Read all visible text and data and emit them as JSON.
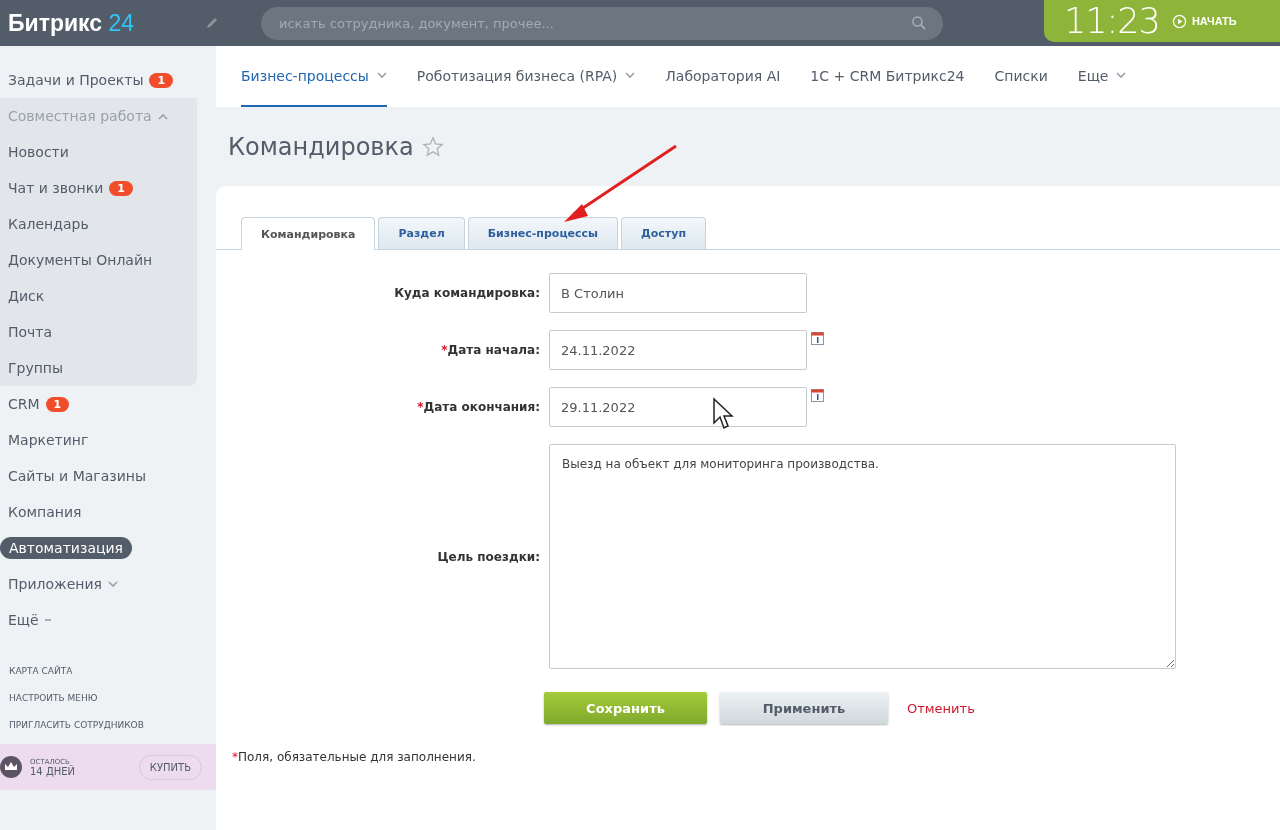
{
  "header": {
    "logo_text": "Битрикс",
    "logo_number": "24",
    "search": {
      "placeholder": "искать сотрудника, документ, прочее..."
    },
    "clock": {
      "time": "11:23",
      "action": "НАЧАТЬ"
    }
  },
  "sidebar": {
    "items": [
      {
        "kind": "link",
        "label": "Задачи и Проекты",
        "badge": "1",
        "selected": false
      },
      {
        "kind": "group",
        "label": "Совместная работа",
        "expanded": true,
        "selected": false,
        "children": [
          {
            "kind": "link",
            "label": "Новости",
            "selected": false
          },
          {
            "kind": "link",
            "label": "Чат и звонки",
            "badge": "1",
            "selected": false
          },
          {
            "kind": "link",
            "label": "Календарь",
            "selected": false
          },
          {
            "kind": "link",
            "label": "Документы Онлайн",
            "selected": false
          },
          {
            "kind": "link",
            "label": "Диск",
            "selected": false
          },
          {
            "kind": "link",
            "label": "Почта",
            "selected": false
          },
          {
            "kind": "link",
            "label": "Группы",
            "selected": false
          }
        ]
      },
      {
        "kind": "link",
        "label": "CRM",
        "badge": "1",
        "selected": false
      },
      {
        "kind": "link",
        "label": "Маркетинг",
        "selected": false
      },
      {
        "kind": "link",
        "label": "Сайты и Магазины",
        "selected": false
      },
      {
        "kind": "link",
        "label": "Компания",
        "selected": false
      },
      {
        "kind": "link",
        "label": "Автоматизация",
        "selected": true
      },
      {
        "kind": "dropdown",
        "label": "Приложения",
        "selected": false
      },
      {
        "kind": "more",
        "label": "Ещё",
        "selected": false
      }
    ],
    "footer_links": [
      "КАРТА САЙТА",
      "НАСТРОИТЬ МЕНЮ",
      "ПРИГЛАСИТЬ СОТРУДНИКОВ"
    ],
    "trial": {
      "caption": "ОСТАЛОСЬ",
      "days": "14 ДНЕЙ",
      "button": "КУПИТЬ"
    }
  },
  "top_nav": [
    {
      "label": "Бизнес-процессы",
      "has_menu": true,
      "selected": true
    },
    {
      "label": "Роботизация бизнеса (RPA)",
      "has_menu": true,
      "selected": false
    },
    {
      "label": "Лаборатория AI",
      "has_menu": false,
      "selected": false
    },
    {
      "label": "1С + CRM Битрикс24",
      "has_menu": false,
      "selected": false
    },
    {
      "label": "Списки",
      "has_menu": false,
      "selected": false
    },
    {
      "label": "Еще",
      "has_menu": true,
      "selected": false
    }
  ],
  "page_title": "Командировка",
  "tabs": [
    {
      "label": "Командировка",
      "selected": true
    },
    {
      "label": "Раздел",
      "selected": false
    },
    {
      "label": "Бизнес-процессы",
      "selected": false
    },
    {
      "label": "Доступ",
      "selected": false
    }
  ],
  "form": {
    "required_mark": "*",
    "fields": [
      {
        "kind": "text",
        "label": "Куда командировка:",
        "required": false,
        "value": "В Столин"
      },
      {
        "kind": "date",
        "label": "Дата начала:",
        "required": true,
        "value": "24.11.2022"
      },
      {
        "kind": "date",
        "label": "Дата окончания:",
        "required": true,
        "value": "29.11.2022"
      },
      {
        "kind": "textarea",
        "label": "Цель поездки:",
        "required": false,
        "value": "Выезд на объект для мониторинга производства."
      }
    ],
    "buttons": [
      {
        "kind": "primary",
        "label": "Сохранить"
      },
      {
        "kind": "secondary",
        "label": "Применить"
      },
      {
        "kind": "link",
        "label": "Отменить"
      }
    ],
    "footnote": {
      "mark": "*",
      "text": "Поля, обязательные для заполнения."
    }
  }
}
